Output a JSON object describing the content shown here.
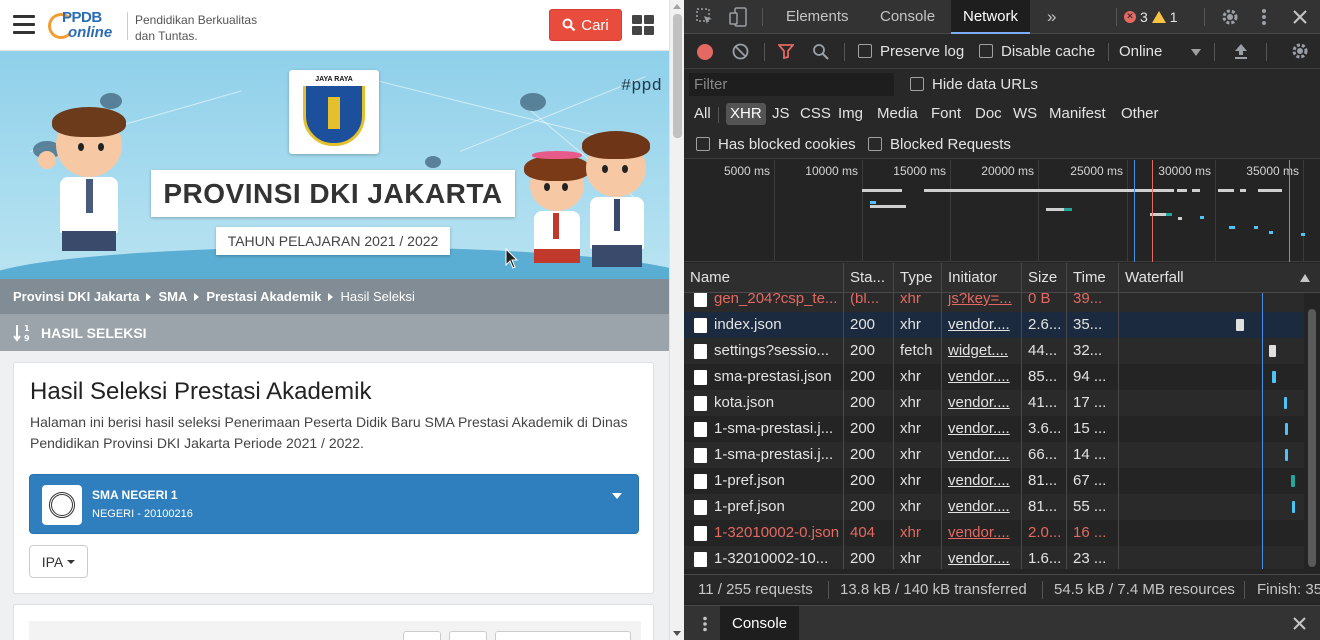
{
  "site": {
    "logo_top": "PPDB",
    "logo_bottom": "online",
    "tagline_line1": "Pendidikan Berkualitas",
    "tagline_line2": "dan Tuntas.",
    "search_button": "Cari",
    "banner": {
      "hashtag": "#ppd",
      "crest_text": "JAYA RAYA",
      "title": "PROVINSI DKI JAKARTA",
      "subtitle": "TAHUN PELAJARAN 2021 / 2022"
    },
    "breadcrumb": [
      "Provinsi DKI Jakarta",
      "SMA",
      "Prestasi Akademik",
      "Hasil Seleksi"
    ],
    "section_title": "HASIL SELEKSI",
    "page_heading": "Hasil Seleksi Prestasi Akademik",
    "description": "Halaman ini berisi hasil seleksi Penerimaan Peserta Didik Baru SMA Prestasi Akademik di Dinas Pendidikan Provinsi DKI Jakarta Periode 2021 / 2022.",
    "school": {
      "name": "SMA NEGERI 1",
      "code": "NEGERI - 20100216"
    },
    "major_button": "IPA"
  },
  "devtools": {
    "tabs": [
      "Elements",
      "Console",
      "Network"
    ],
    "active_tab": "Network",
    "more_tabs": "»",
    "error_count": "3",
    "warning_count": "1",
    "toolbar": {
      "preserve_log": "Preserve log",
      "disable_cache": "Disable cache",
      "throttle": "Online"
    },
    "filter_placeholder": "Filter",
    "hide_data_urls": "Hide data URLs",
    "type_filters": [
      "All",
      "XHR",
      "JS",
      "CSS",
      "Img",
      "Media",
      "Font",
      "Doc",
      "WS",
      "Manifest",
      "Other"
    ],
    "active_type": "XHR",
    "has_blocked_cookies": "Has blocked cookies",
    "blocked_requests": "Blocked Requests",
    "overview_ticks": [
      "5000 ms",
      "10000 ms",
      "15000 ms",
      "20000 ms",
      "25000 ms",
      "30000 ms",
      "35000 ms"
    ],
    "columns": [
      "Name",
      "Sta...",
      "Type",
      "Initiator",
      "Size",
      "Time",
      "Waterfall"
    ],
    "rows": [
      {
        "name": "gen_204?csp_te...",
        "status": "(bl...",
        "type": "xhr",
        "initiator": "js?key=...",
        "size": "0 B",
        "time": "39...",
        "error": true
      },
      {
        "name": "index.json",
        "status": "200",
        "type": "xhr",
        "initiator": "vendor....",
        "size": "2.6...",
        "time": "35...",
        "error": false
      },
      {
        "name": "settings?sessio...",
        "status": "200",
        "type": "fetch",
        "initiator": "widget....",
        "size": "44...",
        "time": "32...",
        "error": false
      },
      {
        "name": "sma-prestasi.json",
        "status": "200",
        "type": "xhr",
        "initiator": "vendor....",
        "size": "85...",
        "time": "94 ...",
        "error": false
      },
      {
        "name": "kota.json",
        "status": "200",
        "type": "xhr",
        "initiator": "vendor....",
        "size": "41...",
        "time": "17 ...",
        "error": false
      },
      {
        "name": "1-sma-prestasi.j...",
        "status": "200",
        "type": "xhr",
        "initiator": "vendor....",
        "size": "3.6...",
        "time": "15 ...",
        "error": false
      },
      {
        "name": "1-sma-prestasi.j...",
        "status": "200",
        "type": "xhr",
        "initiator": "vendor....",
        "size": "66...",
        "time": "14 ...",
        "error": false
      },
      {
        "name": "1-pref.json",
        "status": "200",
        "type": "xhr",
        "initiator": "vendor....",
        "size": "81...",
        "time": "67 ...",
        "error": false
      },
      {
        "name": "1-pref.json",
        "status": "200",
        "type": "xhr",
        "initiator": "vendor....",
        "size": "81...",
        "time": "55 ...",
        "error": false
      },
      {
        "name": "1-32010002-0.json",
        "status": "404",
        "type": "xhr",
        "initiator": "vendor....",
        "size": "2.0...",
        "time": "16 ...",
        "error": true
      },
      {
        "name": "1-32010002-10...",
        "status": "200",
        "type": "xhr",
        "initiator": "vendor....",
        "size": "1.6...",
        "time": "23 ...",
        "error": false
      }
    ],
    "status": {
      "requests": "11 / 255 requests",
      "transferred": "13.8 kB / 140 kB transferred",
      "resources": "54.5 kB / 7.4 MB resources",
      "finish": "Finish: 35"
    },
    "drawer_tab": "Console"
  }
}
